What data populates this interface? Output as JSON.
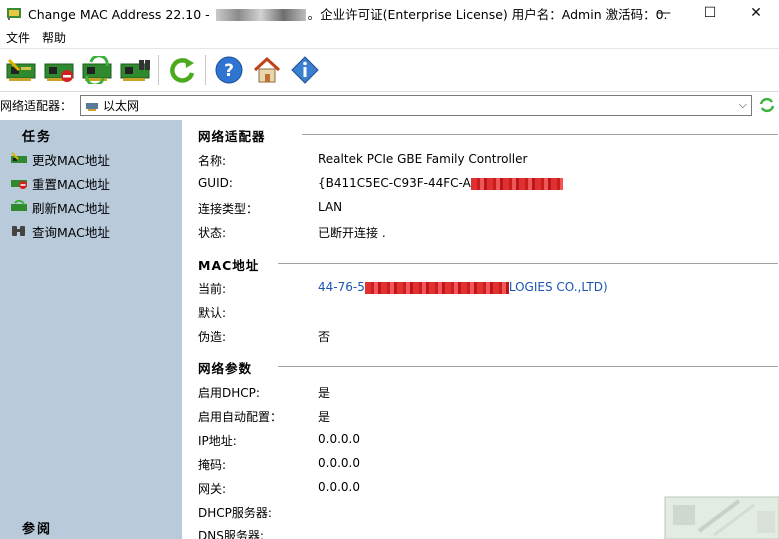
{
  "window": {
    "title_prefix": "Change MAC Address 22.10 - ",
    "title_suffix": "。企业许可证(Enterprise License) 用户名：Admin 激活码：0...",
    "minimize": "—",
    "maximize": "☐",
    "close": "✕"
  },
  "menu": {
    "file": "文件",
    "help": "帮助"
  },
  "adapter": {
    "label": "网络适配器：",
    "selected": "以太网"
  },
  "left": {
    "tasks_title": "任务",
    "tasks": [
      "更改MAC地址",
      "重置MAC地址",
      "刷新MAC地址",
      "查询MAC地址"
    ],
    "ref_title": "参阅"
  },
  "sections": {
    "adapter": {
      "title": "网络适配器",
      "name_label": "名称:",
      "name_value": "Realtek PCIe GBE Family Controller",
      "guid_label": "GUID:",
      "guid_value": "{B411C5EC-C93F-44FC-A",
      "conn_label": "连接类型：",
      "conn_value": "LAN",
      "status_label": "状态:",
      "status_value": "已断开连接 ."
    },
    "mac": {
      "title": "MAC地址",
      "current_label": "当前:",
      "current_value_start": "44-76-5",
      "current_value_end": "LOGIES CO.,LTD)",
      "default_label": "默认:",
      "spoof_label": "伪造:",
      "spoof_value": "否"
    },
    "net": {
      "title": "网络参数",
      "dhcp_label": "启用DHCP:",
      "dhcp_value": "是",
      "autoconf_label": "启用自动配置：",
      "autoconf_value": "是",
      "ip_label": "IP地址:",
      "ip_value": "0.0.0.0",
      "mask_label": "掩码:",
      "mask_value": "0.0.0.0",
      "gateway_label": "网关:",
      "gateway_value": "0.0.0.0",
      "dhcp_server_label": "DHCP服务器:",
      "dns_label": "DNS服务器:"
    }
  },
  "colors": {
    "left_pane": "#b9cadb",
    "link": "#1a55b3"
  }
}
